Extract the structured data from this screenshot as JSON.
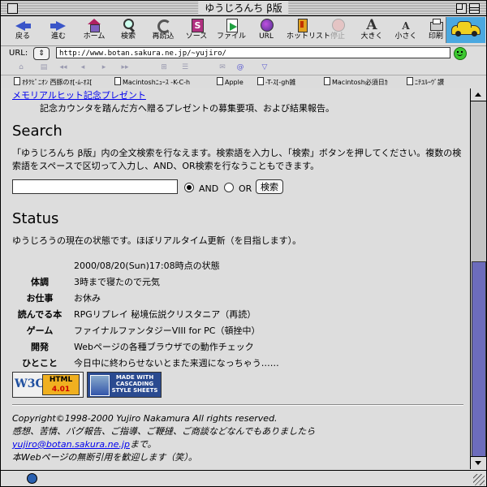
{
  "window": {
    "title": "ゆうじろんち β版"
  },
  "toolbar": {
    "buttons": [
      {
        "label": "戻る"
      },
      {
        "label": "進む"
      },
      {
        "label": "ホーム"
      },
      {
        "label": "検索"
      },
      {
        "label": "再読込"
      },
      {
        "label": "ソース"
      },
      {
        "label": "ファイル"
      },
      {
        "label": "URL"
      },
      {
        "label": "ホットリスト"
      },
      {
        "label": "停止"
      },
      {
        "label": "大きく"
      },
      {
        "label": "小さく"
      },
      {
        "label": "印刷"
      }
    ],
    "big_glyph": "A",
    "small_glyph": "A"
  },
  "urlbar": {
    "label": "URL:",
    "value": "http://www.botan.sakura.ne.jp/~yujiro/",
    "dropdown": "⇕"
  },
  "minibar": {
    "glyphs": [
      "⌂",
      "▤",
      "◂◂",
      "◂",
      "▸",
      "▸▸",
      "⊞",
      "☰",
      "✉",
      "@",
      "▽"
    ]
  },
  "favorites": [
    "ｵﾀｸﾋﾟﾆｵﾝ 西豚のｵ[-ﾑ-ｵｽ[",
    "Macintoshﾆｭｰｽ -K-C-h",
    "Apple",
    "-T-ｽ[-gh雑",
    "Macintosh必須日ｶ",
    "ﾆﾁﾕﾙｰｳﾞ讃"
  ],
  "content": {
    "memorial_link": "メモリアルヒット記念プレゼント",
    "memorial_desc": "記念カウンタを踏んだ方へ贈るプレゼントの募集要項、および結果報告。",
    "search": {
      "heading": "Search",
      "description": "「ゆうじろんち β版」内の全文検索を行なえます。検索語を入力し、「検索」ボタンを押してください。複数の検索語をスペースで区切って入力し、AND、OR検索を行なうこともできます。",
      "input_value": "",
      "and_label": "AND",
      "or_label": "OR",
      "button_label": "検索"
    },
    "status": {
      "heading": "Status",
      "description": "ゆうじろうの現在の状態です。ほぼリアルタイム更新（を目指します）。",
      "timestamp": "2000/08/20(Sun)17:08時点の状態",
      "rows": [
        {
          "key": "体調",
          "value": "3時まで寝たので元気"
        },
        {
          "key": "お仕事",
          "value": "お休み"
        },
        {
          "key": "読んでる本",
          "value": "RPGリプレイ 秘境伝説クリスタニア（再読）"
        },
        {
          "key": "ゲーム",
          "value": "ファイナルファンタジーVIII for PC（頓挫中）"
        },
        {
          "key": "開発",
          "value": "Webページの各種ブラウザでの動作チェック"
        },
        {
          "key": "ひとこと",
          "value": "今日中に終わらせないとまた来週になっちゃう……"
        }
      ]
    },
    "badges": {
      "w3c_logo": "W3C",
      "w3c_line1": "HTML",
      "w3c_line2": "4.01",
      "css_line1": "MADE WITH",
      "css_line2": "CASCADING",
      "css_line3": "STYLE SHEETS"
    },
    "footer": {
      "copyright": "Copyright©1998-2000 Yujiro Nakamura All rights reserved.",
      "line2": "感想、苦情、バグ報告、ご指導、ご鞭撻、ご商談などなんでもありましたら",
      "email": "yujiro@botan.sakura.ne.jp",
      "email_suffix": "まで。",
      "line4": "本Webページの無断引用を歓迎します（笑）。"
    }
  }
}
